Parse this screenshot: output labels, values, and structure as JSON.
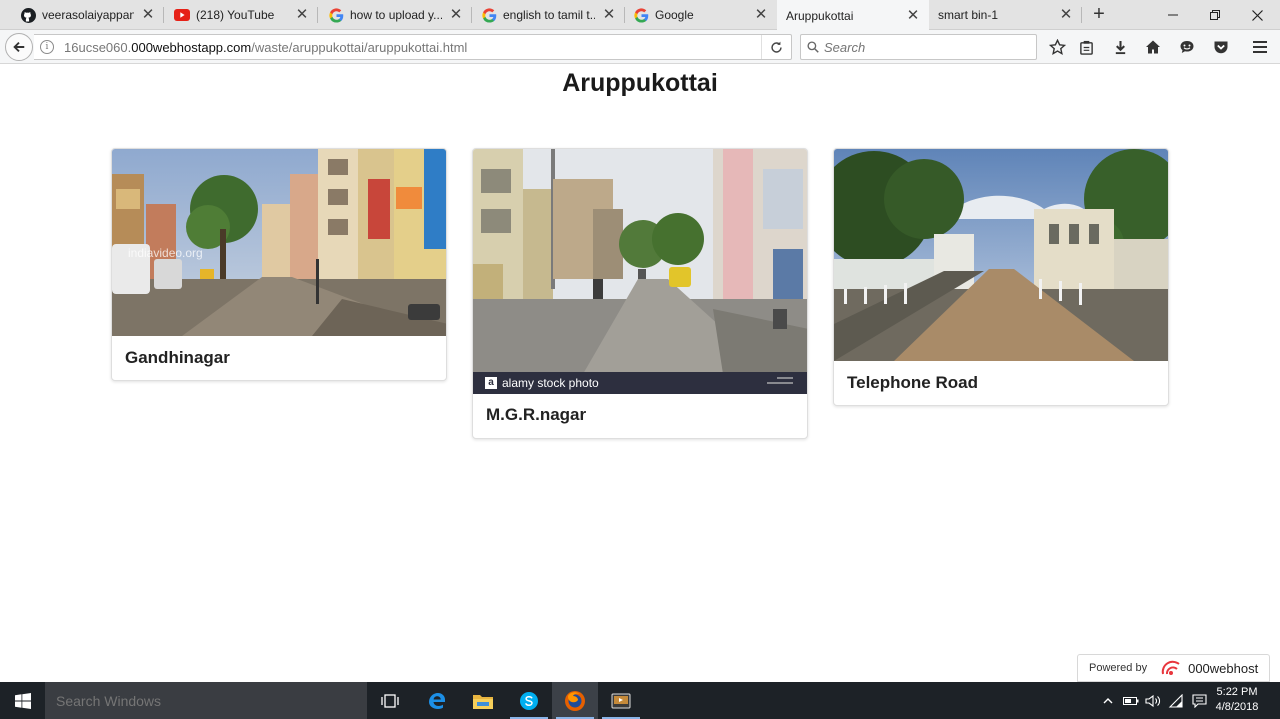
{
  "browser": {
    "tabs": [
      {
        "label": "veerasolaiyappan...",
        "icon": "github-icon"
      },
      {
        "label": "(218) YouTube",
        "icon": "youtube-icon"
      },
      {
        "label": "how to upload y...",
        "icon": "google-icon"
      },
      {
        "label": "english to tamil t...",
        "icon": "google-icon"
      },
      {
        "label": "Google",
        "icon": "google-icon"
      },
      {
        "label": "Aruppukottai",
        "icon": "none",
        "active": true
      },
      {
        "label": "smart bin-1",
        "icon": "none"
      }
    ],
    "url": {
      "prefix": "16ucse060.",
      "domain": "000webhostapp.com",
      "path": "/waste/aruppukottai/aruppukottai.html"
    },
    "search_placeholder": "Search"
  },
  "page": {
    "title": "Aruppukottai",
    "cards": [
      {
        "caption": "Gandhinagar",
        "watermark": "indiavideo.org"
      },
      {
        "caption": "M.G.R.nagar",
        "stock_label": "alamy stock photo"
      },
      {
        "caption": "Telephone Road"
      }
    ],
    "powered_by": {
      "label": "Powered by",
      "brand": "000webhost"
    }
  },
  "taskbar": {
    "search_placeholder": "Search Windows",
    "time": "5:22 PM",
    "date": "4/8/2018"
  },
  "colors": {
    "tab_strip": "#e3e3e3",
    "active_tab": "#f5f6f7",
    "taskbar": "#1d2227",
    "alamy_bar": "#2d2f3f",
    "brand_red": "#e8363d"
  }
}
